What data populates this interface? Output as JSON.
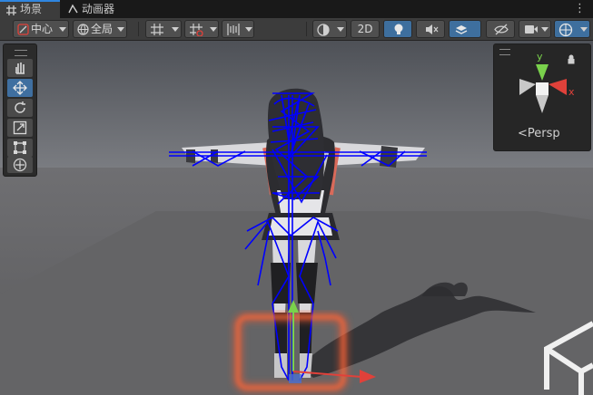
{
  "tabs": [
    {
      "label": "场景",
      "icon": "grid-icon",
      "active": true
    },
    {
      "label": "动画器",
      "icon": "animator-icon",
      "active": false
    }
  ],
  "toolbar": {
    "pivot_label": "中心",
    "space_label": "全局",
    "mode_2d_label": "2D"
  },
  "gizmo": {
    "y_axis_label": "y",
    "x_axis_label": "x",
    "projection_label": "Persp"
  },
  "colors": {
    "accent": "#2f86e0",
    "selected_button": "#3e6f9e",
    "bone_color": "#0000ff",
    "y_axis": "#7ad14c",
    "x_axis": "#e0413a"
  }
}
